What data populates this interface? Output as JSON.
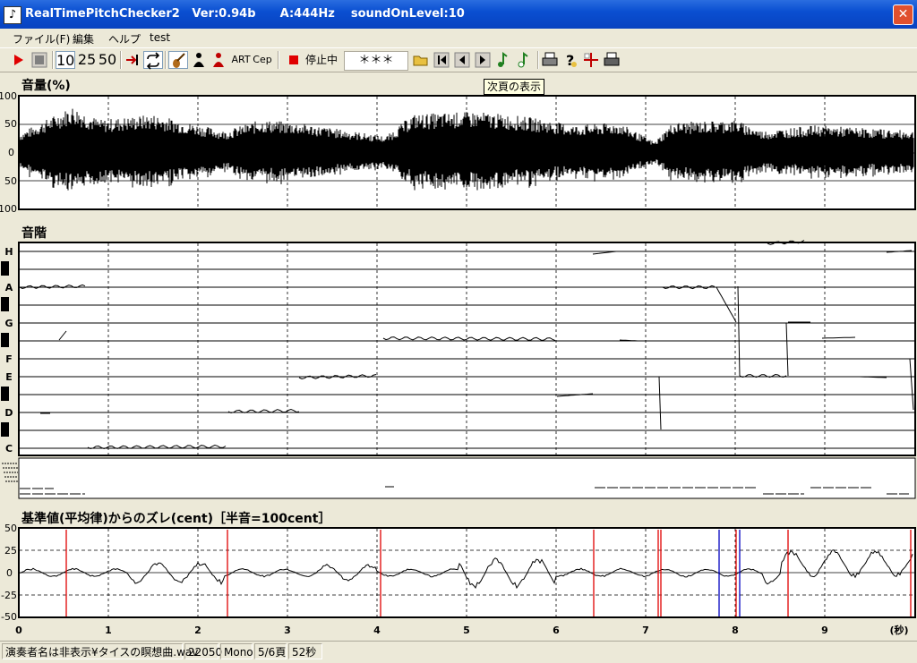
{
  "window": {
    "title": "RealTimePitchChecker2   Ver:0.94b      A:444Hz    soundOnLevel:10",
    "close_symbol": "✕"
  },
  "menu": [
    "ファイル(F)",
    "編集",
    "ヘルプ",
    "test"
  ],
  "toolbar": {
    "play_icon": "play-icon",
    "stop_icon": "stop-icon",
    "scale_10": "10",
    "scale_25": "25",
    "scale_50": "50",
    "art_label": "ART",
    "cep_label": "Cep",
    "status_label": "停止中",
    "status_value": "＊＊＊",
    "tooltip": "次頁の表示"
  },
  "panels": {
    "volume_title": "音量(%)",
    "pitch_title": "音階",
    "cent_title": "基準値(平均律)からのズレ(cent)［半音=100cent］"
  },
  "volume_axis": [
    "100",
    "50",
    "0",
    "50",
    "100"
  ],
  "note_names": [
    "H",
    "A",
    "G",
    "F",
    "E",
    "D",
    "C"
  ],
  "cent_axis": [
    "50",
    "25",
    "0",
    "-25",
    "-50"
  ],
  "time_axis": {
    "ticks": [
      "0",
      "1",
      "2",
      "3",
      "4",
      "5",
      "6",
      "7",
      "8",
      "9"
    ],
    "unit": "(秒)"
  },
  "statusbar": {
    "file": "演奏者名は非表示¥タイスの瞑想曲.wav",
    "rate": "22050",
    "channels": "Mono",
    "page": "5/6頁",
    "duration": "52秒"
  },
  "colors": {
    "title_bar": "#0a4fd1",
    "window_bg": "#ece9d8",
    "plot_bg": "#ffffff",
    "trace": "#000000",
    "red_marker": "#e00000",
    "blue_marker": "#0000c0"
  }
}
